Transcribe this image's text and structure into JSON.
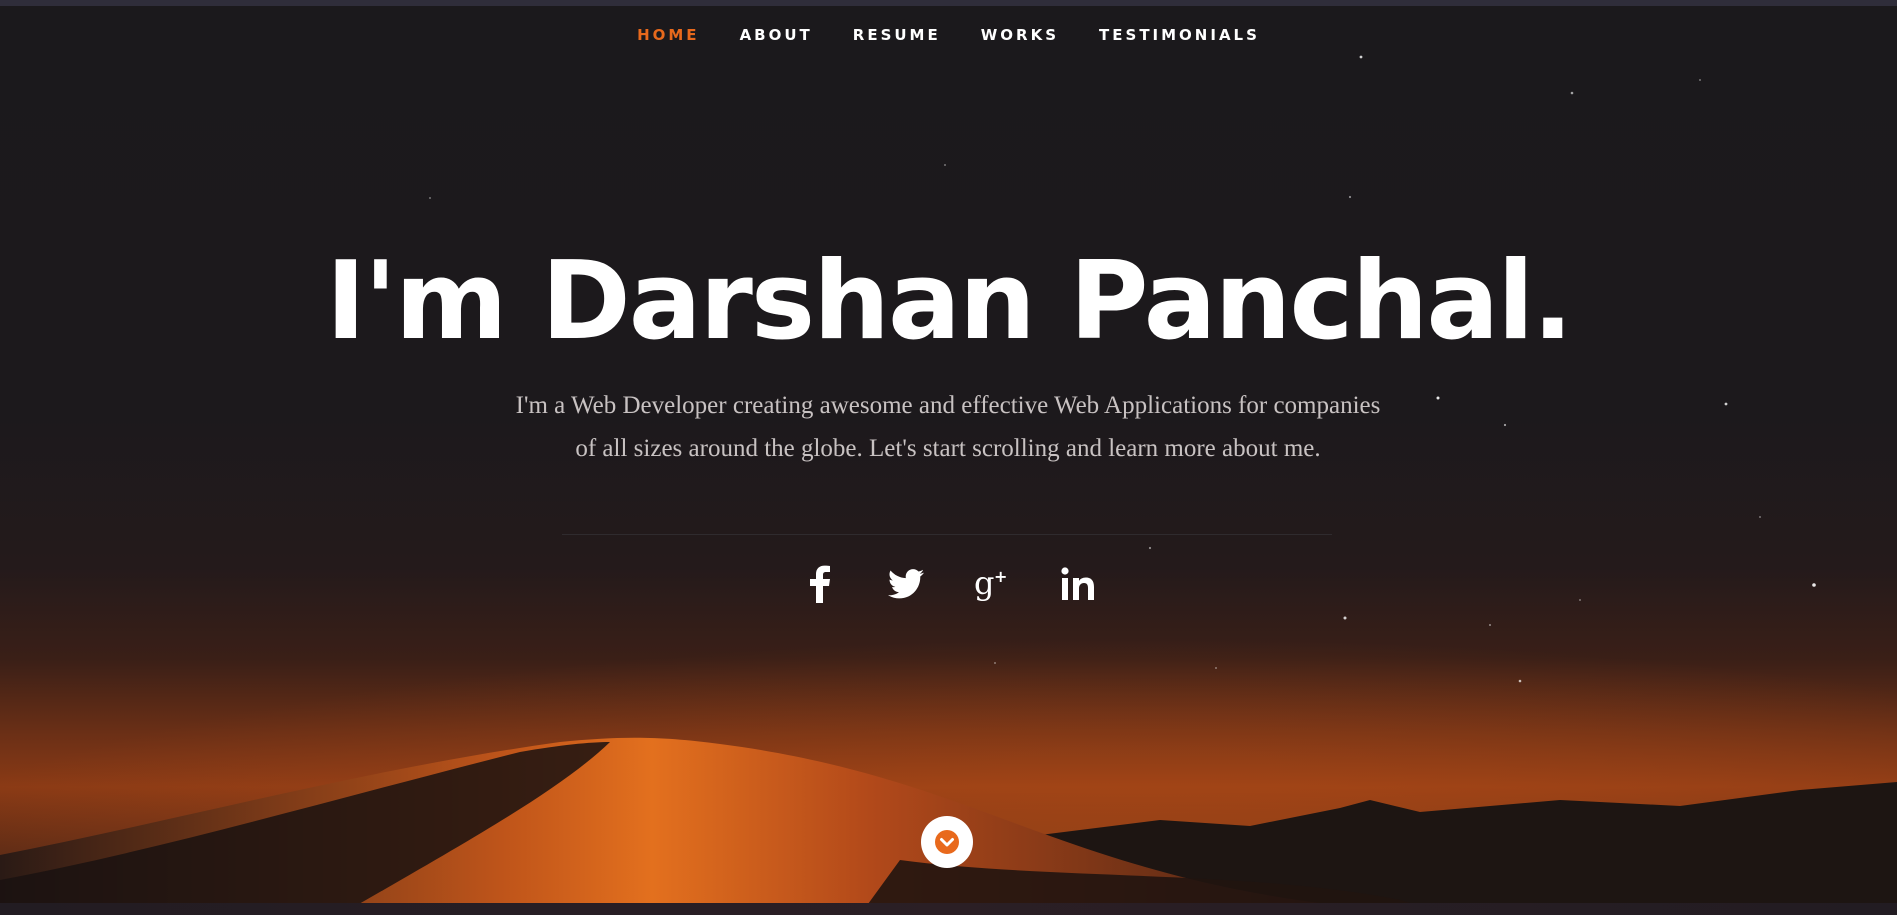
{
  "nav": {
    "items": [
      {
        "label": "HOME",
        "active": true
      },
      {
        "label": "ABOUT",
        "active": false
      },
      {
        "label": "RESUME",
        "active": false
      },
      {
        "label": "WORKS",
        "active": false
      },
      {
        "label": "TESTIMONIALS",
        "active": false
      }
    ]
  },
  "hero": {
    "title": "I'm Darshan Panchal.",
    "description": "I'm a Web Developer creating awesome and effective Web Applications for companies of all sizes around the globe. Let's start scrolling and learn more about me."
  },
  "social": [
    {
      "icon": "facebook-icon"
    },
    {
      "icon": "twitter-icon"
    },
    {
      "icon": "google-plus-icon"
    },
    {
      "icon": "linkedin-icon"
    }
  ],
  "scroll_down": {
    "icon": "chevron-down-icon"
  },
  "colors": {
    "accent": "#e8691c",
    "background": "#1c1a1d",
    "text": "#ffffff",
    "muted_text": "#c8c2c2"
  }
}
